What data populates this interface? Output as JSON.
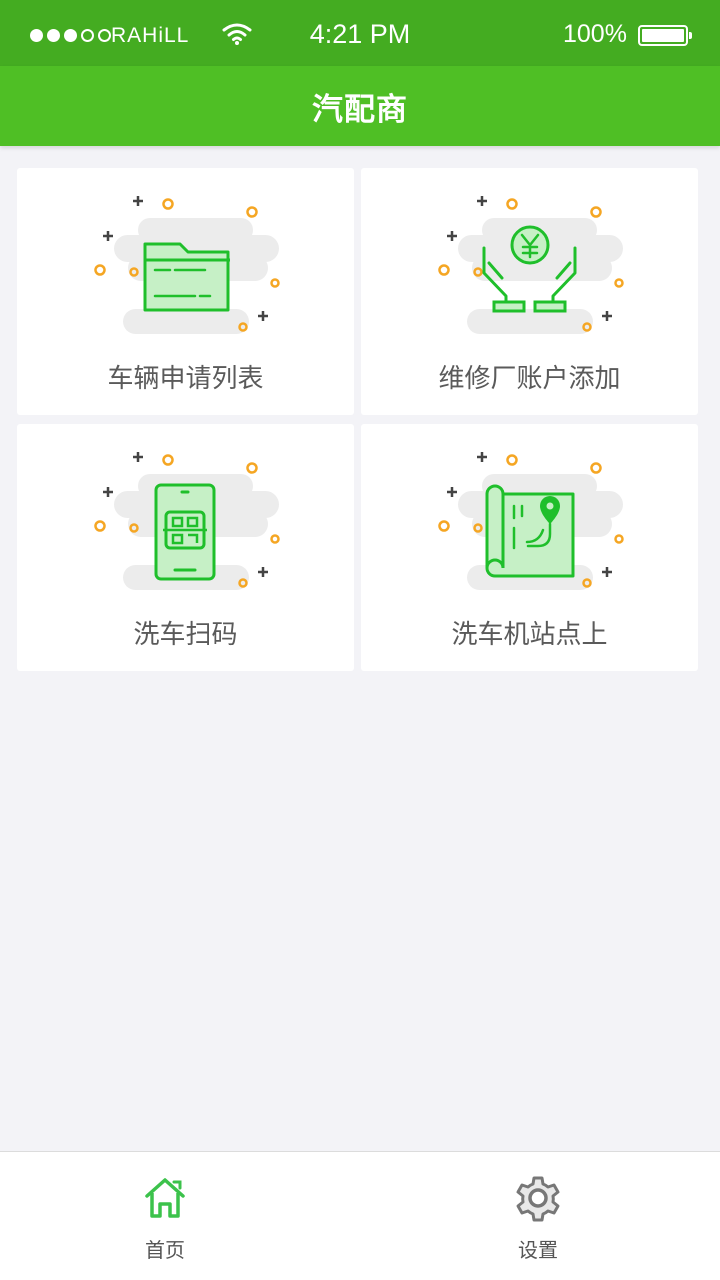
{
  "status_bar": {
    "carrier": "RAHiLL",
    "time": "4:21 PM",
    "battery": "100%"
  },
  "header": {
    "title": "汽配商"
  },
  "grid": {
    "items": [
      {
        "label": "车辆申请列表",
        "icon": "folder-icon"
      },
      {
        "label": "维修厂账户添加",
        "icon": "hands-yen-icon"
      },
      {
        "label": "洗车扫码",
        "icon": "phone-qr-icon"
      },
      {
        "label": "洗车机站点上",
        "icon": "map-pin-icon"
      }
    ]
  },
  "tab_bar": {
    "tabs": [
      {
        "label": "首页",
        "icon": "home-icon",
        "active": true
      },
      {
        "label": "设置",
        "icon": "gear-icon",
        "active": false
      }
    ]
  },
  "colors": {
    "status_bar": "#44ac21",
    "nav_bar": "#4fbf25",
    "accent": "#1fbf2b",
    "dot_orange": "#f5a623"
  }
}
